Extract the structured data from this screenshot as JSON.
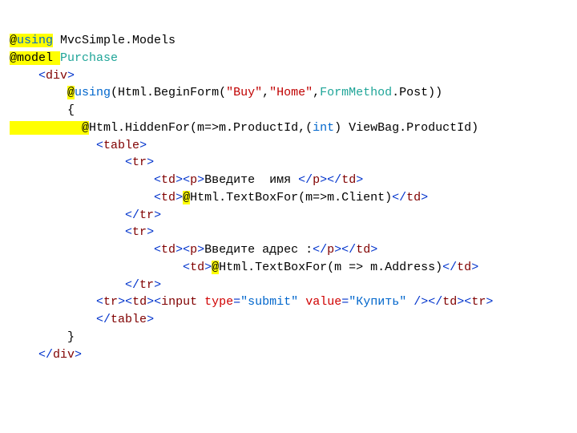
{
  "code": {
    "l1": {
      "at": "@",
      "using": "using",
      "ns": " MvcSimple.Models"
    },
    "l2": {
      "atmodel": "@model ",
      "type": "Purchase"
    },
    "l3": {
      "indent": "    ",
      "div_open": "div"
    },
    "l4": {
      "indent": "        ",
      "at": "@",
      "using": "using",
      "open": "(Html.BeginForm(",
      "s1": "\"Buy\"",
      "c1": ",",
      "s2": "\"Home\"",
      "c2": ",",
      "fm": "FormMethod",
      "rest": ".Post))"
    },
    "l5": {
      "indent": "        ",
      "brace": "{"
    },
    "l6": {
      "indent": "          ",
      "at": "@",
      "pre": "Html.HiddenFor(m=>m.ProductId,(",
      "int": "int",
      "post": ") ViewBag.ProductId)"
    },
    "l7": {
      "indent": "            ",
      "tag": "table"
    },
    "l8": {
      "indent": "                ",
      "tag": "tr"
    },
    "l9": {
      "indent": "                    ",
      "td": "td",
      "p": "p",
      "text": "Введите  имя "
    },
    "l10": {
      "indent": "                    ",
      "td": "td",
      "at": "@",
      "expr": "Html.TextBoxFor(m=>m.Client)"
    },
    "l11": {
      "indent": "                ",
      "tag": "tr"
    },
    "l12": {
      "indent": "                ",
      "tag": "tr"
    },
    "l13": {
      "indent": "                    ",
      "td": "td",
      "p": "p",
      "text": "Введите адрес :"
    },
    "l14": {
      "indent": "                        ",
      "td": "td",
      "at": "@",
      "expr": "Html.TextBoxFor(m => m.Address)"
    },
    "l15": {
      "indent": "                ",
      "tag": "tr"
    },
    "l16": {
      "indent": "            ",
      "tr": "tr",
      "td": "td",
      "input": "input",
      "sp": " ",
      "attr1": "type",
      "eq1": "=",
      "val1": "\"submit\"",
      "sp2": " ",
      "attr2": "value",
      "eq2": "=",
      "val2": "\"Купить\"",
      "selfclose": " />"
    },
    "l17": {
      "indent": "            ",
      "tag": "table"
    },
    "l18": {
      "indent": "        ",
      "brace": "}"
    },
    "l19": {
      "indent": "    ",
      "tag": "div"
    }
  }
}
